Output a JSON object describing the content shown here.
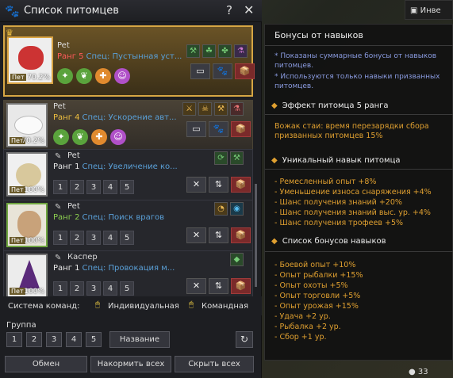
{
  "window": {
    "title": "Список питомцев",
    "help": "?",
    "close": "✕"
  },
  "pets": [
    {
      "name": "Pet",
      "rank": "Ранг 5",
      "spec": "Спец: Пустынная уст...",
      "pct": "70.2%",
      "tag": "Пет"
    },
    {
      "name": "Pet",
      "rank": "Ранг 4",
      "spec": "Спец: Ускорение авт...",
      "pct": "70.2%",
      "tag": "Пет"
    },
    {
      "name": "Pet",
      "rank": "Ранг 1",
      "spec": "Спец: Увеличение ко...",
      "pct": "100%",
      "tag": "Пет"
    },
    {
      "name": "Pet",
      "rank": "Ранг 2",
      "spec": "Спец: Поиск врагов",
      "pct": "100%",
      "tag": "Пет"
    },
    {
      "name": "Каспер",
      "rank": "Ранг 1",
      "spec": "Спец: Провокация м...",
      "pct": "100%",
      "tag": "Пет"
    }
  ],
  "nums": [
    "1",
    "2",
    "3",
    "4",
    "5"
  ],
  "command": {
    "label": "Система команд:",
    "individual": "Индивидуальная",
    "team": "Командная"
  },
  "group": {
    "label": "Группа",
    "b1": "1",
    "b2": "2",
    "b3": "3",
    "b4": "4",
    "b5": "5",
    "name_btn": "Название"
  },
  "footer": {
    "exchange": "Обмен",
    "feed": "Накормить всех",
    "hide": "Скрыть всех"
  },
  "right": {
    "tab": "Инве",
    "title": "Бонусы от навыков",
    "note1": "* Показаны суммарные бонусы от навыков питомцев.",
    "note2": "* Используются только навыки призванных питомцев.",
    "sec1": "Эффект питомца 5 ранга",
    "sec1_text": "Вожак стаи: время перезарядки сбора призванных питомцев  15%",
    "sec2": "Уникальный навык питомца",
    "unique": [
      "- Ремесленный опыт +8%",
      "- Уменьшение износа снаряжения +4%",
      "- Шанс получения знаний +20%",
      "- Шанс получения знаний выс. ур. +4%",
      "- Шанс получения трофеев +5%"
    ],
    "sec3": "Список бонусов навыков",
    "bonuses": [
      "- Боевой опыт +10%",
      "- Опыт рыбалки +15%",
      "- Опыт охоты +5%",
      "- Опыт торговли +5%",
      "- Опыт урожая +15%",
      "- Удача +2 ур.",
      "- Рыбалка +2 ур.",
      "- Сбор +1 ур."
    ],
    "coin": "33"
  },
  "colors": {
    "accent": "#d6a644",
    "rank5": "#ff5a5a",
    "rank4": "#f0c040",
    "rank2": "#8ccf50",
    "spec": "#5aa0d8",
    "bonus": "#e0a030"
  }
}
